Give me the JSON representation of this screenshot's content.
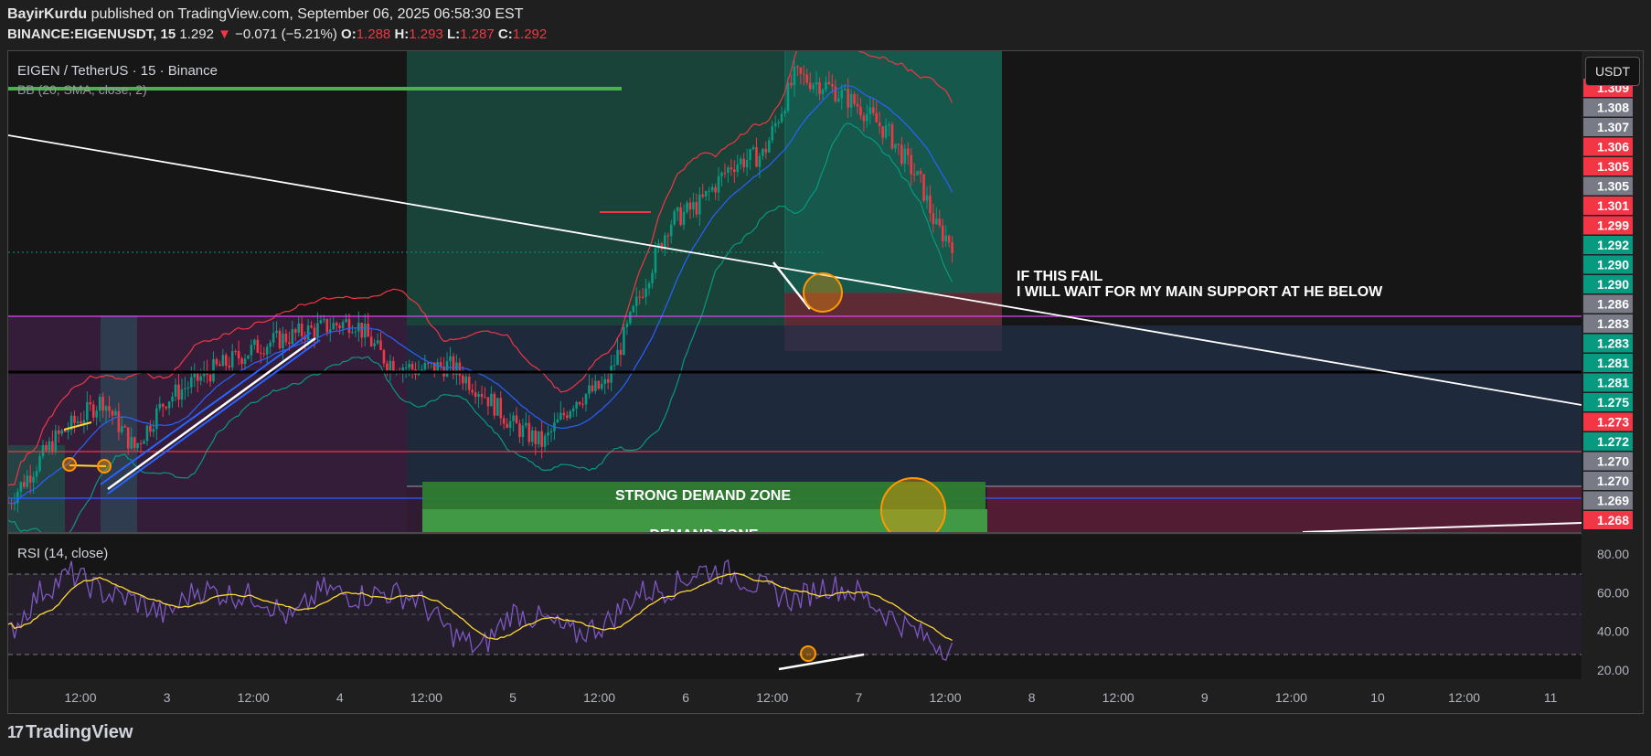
{
  "header": {
    "author": "BayirKurdu",
    "published": "published on TradingView.com, September 06, 2025 06:58:30 EST",
    "symbol": "BINANCE:EIGENUSDT, 15",
    "last": "1.292",
    "arrow": "▼",
    "change": "−0.071 (−5.21%)",
    "o_label": "O:",
    "o_value": "1.288",
    "h_label": "H:",
    "h_value": "1.293",
    "l_label": "L:",
    "l_value": "1.287",
    "c_label": "C:",
    "c_value": "1.292"
  },
  "legend": {
    "title": "EIGEN / TetherUS · 15 · Binance",
    "indicator": "BB (20, SMA, close, 2)",
    "rsi": "RSI (14, close)"
  },
  "currency_button": "USDT",
  "annotations": {
    "note_line1": "IF THIS FAIL",
    "note_line2": "I WILL WAIT FOR MY MAIN SUPPORT AT HE BELOW",
    "zone1": "STRONG DEMAND ZONE",
    "zone2": "DEMAND ZONE"
  },
  "footer": {
    "brand": "TradingView",
    "logo_icon": "tradingview-logo-icon"
  },
  "colors": {
    "background": "#1f1f1f",
    "panel": "#161616",
    "up": "#089981",
    "down": "#f23645",
    "bb_upper": "#f23645",
    "bb_basis": "#2962ff",
    "bb_lower": "#089981",
    "rsi_line": "#7e57c2",
    "rsi_ma": "#fdd835",
    "trendline": "#ffffff",
    "purple_line": "#e040fb",
    "demand_zone": "#2e7d32",
    "circle": "#ff9800"
  },
  "chart_data": {
    "type": "candlestick",
    "price_scale": [
      {
        "value": "1.309",
        "color": "#f23645"
      },
      {
        "value": "1.308",
        "color": "#787b86"
      },
      {
        "value": "1.307",
        "color": "#787b86"
      },
      {
        "value": "1.306",
        "color": "#f23645"
      },
      {
        "value": "1.305",
        "color": "#f23645"
      },
      {
        "value": "1.305",
        "color": "#787b86"
      },
      {
        "value": "1.301",
        "color": "#f23645"
      },
      {
        "value": "1.299",
        "color": "#f23645"
      },
      {
        "value": "1.292",
        "color": "#089981"
      },
      {
        "value": "1.290",
        "color": "#089981"
      },
      {
        "value": "1.290",
        "color": "#089981"
      },
      {
        "value": "1.286",
        "color": "#787b86"
      },
      {
        "value": "1.283",
        "color": "#787b86"
      },
      {
        "value": "1.283",
        "color": "#089981"
      },
      {
        "value": "1.281",
        "color": "#089981"
      },
      {
        "value": "1.281",
        "color": "#089981"
      },
      {
        "value": "1.275",
        "color": "#089981"
      },
      {
        "value": "1.273",
        "color": "#f23645"
      },
      {
        "value": "1.272",
        "color": "#089981"
      },
      {
        "value": "1.270",
        "color": "#787b86"
      },
      {
        "value": "1.270",
        "color": "#787b86"
      },
      {
        "value": "1.269",
        "color": "#787b86"
      },
      {
        "value": "1.268",
        "color": "#f23645"
      }
    ],
    "rsi_scale": [
      "80.00",
      "60.00",
      "40.00",
      "20.00"
    ],
    "rsi_levels": [
      70,
      50,
      30
    ],
    "time_labels": [
      "12:00",
      "3",
      "12:00",
      "4",
      "12:00",
      "5",
      "12:00",
      "6",
      "12:00",
      "7",
      "12:00",
      "8",
      "12:00",
      "9",
      "12:00",
      "10",
      "12:00",
      "11"
    ],
    "price_path": [
      [
        0.0,
        1.2655
      ],
      [
        0.03,
        1.272
      ],
      [
        0.06,
        1.276
      ],
      [
        0.08,
        1.271
      ],
      [
        0.1,
        1.276
      ],
      [
        0.13,
        1.279
      ],
      [
        0.16,
        1.2815
      ],
      [
        0.19,
        1.283
      ],
      [
        0.22,
        1.284
      ],
      [
        0.24,
        1.28
      ],
      [
        0.26,
        1.279
      ],
      [
        0.28,
        1.2795
      ],
      [
        0.3,
        1.277
      ],
      [
        0.32,
        1.2735
      ],
      [
        0.34,
        1.2715
      ],
      [
        0.36,
        1.276
      ],
      [
        0.38,
        1.2775
      ],
      [
        0.4,
        1.286
      ],
      [
        0.42,
        1.294
      ],
      [
        0.44,
        1.296
      ],
      [
        0.46,
        1.3
      ],
      [
        0.48,
        1.301
      ],
      [
        0.5,
        1.309
      ],
      [
        0.52,
        1.308
      ],
      [
        0.54,
        1.306
      ],
      [
        0.56,
        1.303
      ],
      [
        0.58,
        1.298
      ],
      [
        0.59,
        1.2935
      ],
      [
        0.6,
        1.292
      ]
    ],
    "rsi_path": [
      [
        0.0,
        38
      ],
      [
        0.02,
        60
      ],
      [
        0.04,
        70
      ],
      [
        0.06,
        60
      ],
      [
        0.08,
        56
      ],
      [
        0.1,
        48
      ],
      [
        0.12,
        62
      ],
      [
        0.14,
        59
      ],
      [
        0.16,
        58
      ],
      [
        0.18,
        46
      ],
      [
        0.2,
        62
      ],
      [
        0.22,
        58
      ],
      [
        0.24,
        60
      ],
      [
        0.26,
        57
      ],
      [
        0.28,
        40
      ],
      [
        0.3,
        30
      ],
      [
        0.32,
        50
      ],
      [
        0.34,
        46
      ],
      [
        0.36,
        38
      ],
      [
        0.38,
        44
      ],
      [
        0.4,
        60
      ],
      [
        0.42,
        62
      ],
      [
        0.44,
        72
      ],
      [
        0.46,
        70
      ],
      [
        0.48,
        62
      ],
      [
        0.5,
        56
      ],
      [
        0.52,
        64
      ],
      [
        0.54,
        60
      ],
      [
        0.56,
        48
      ],
      [
        0.58,
        38
      ],
      [
        0.6,
        30
      ]
    ]
  }
}
